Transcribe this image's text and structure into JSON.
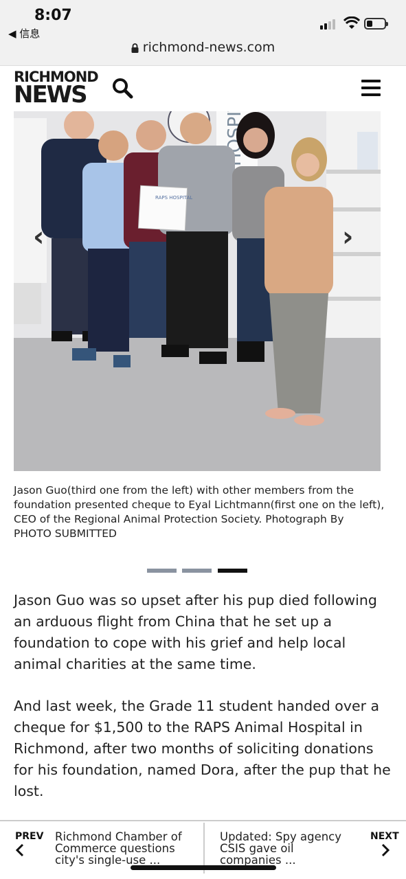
{
  "status": {
    "time": "8:07",
    "back_label": "◀ 信息",
    "url": "richmond-news.com"
  },
  "header": {
    "logo_line1": "RICHMOND",
    "logo_line2": "NEWS"
  },
  "photo": {
    "caption": "Jason Guo(third one from the left) with other members from the foundation presented cheque to Eyal Lichtmann(first one on the left), CEO of the Regional Animal Protection Society. Photograph By PHOTO SUBMITTED",
    "certificate_text": "RAPS HOSPITAL",
    "wall_text": "HOSPITA",
    "slide_count": 3,
    "active_slide": 3
  },
  "article": {
    "paragraphs": [
      "Jason Guo was so upset after his pup died following an arduous flight from China that he set up a foundation to cope with his grief and help local animal charities at the same time.",
      "And last week, the Grade 11 student handed over a cheque for $1,500 to the RAPS Animal Hospital in Richmond, after two months of soliciting donations for his foundation, named Dora, after the pup that he lost."
    ]
  },
  "pager": {
    "prev_label": "PREV",
    "prev_title": "Richmond Chamber of Commerce questions city's single-use ...",
    "next_label": "NEXT",
    "next_title": "Updated: Spy agency CSIS gave oil companies ..."
  }
}
